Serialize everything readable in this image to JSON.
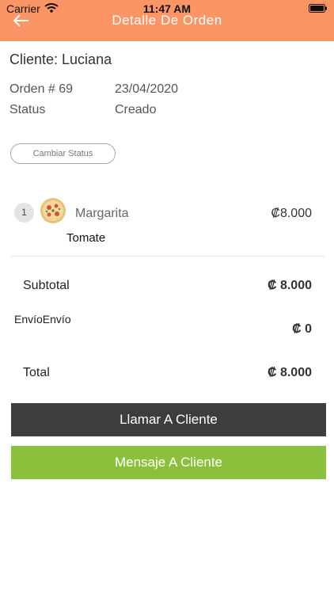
{
  "status_bar": {
    "carrier": "Carrier",
    "time": "11:47 AM"
  },
  "header": {
    "title": "Detalle De Orden",
    "back_icon": "arrow-left-icon",
    "background": "#fc9566"
  },
  "order": {
    "client_label": "Cliente: Luciana",
    "order_label": "Orden # 69",
    "date": "23/04/2020",
    "status_label": "Status",
    "status_value": "Creado",
    "change_status_button": "Cambiar Status"
  },
  "items": [
    {
      "quantity": "1",
      "name": "Margarita",
      "price": "₡8.000",
      "topping": "Tomate",
      "image_icon": "pizza-icon"
    }
  ],
  "summary": {
    "subtotal_label": "Subtotal",
    "subtotal_value": "₡ 8.000",
    "shipping_label": "EnvíoEnvío",
    "shipping_value": "₡ 0",
    "total_label": "Total",
    "total_value": "₡ 8.000"
  },
  "actions": {
    "call_label": "Llamar A Cliente",
    "message_label": "Mensaje A Cliente",
    "call_color": "#3d3d3d",
    "message_color": "#8bc03c"
  }
}
